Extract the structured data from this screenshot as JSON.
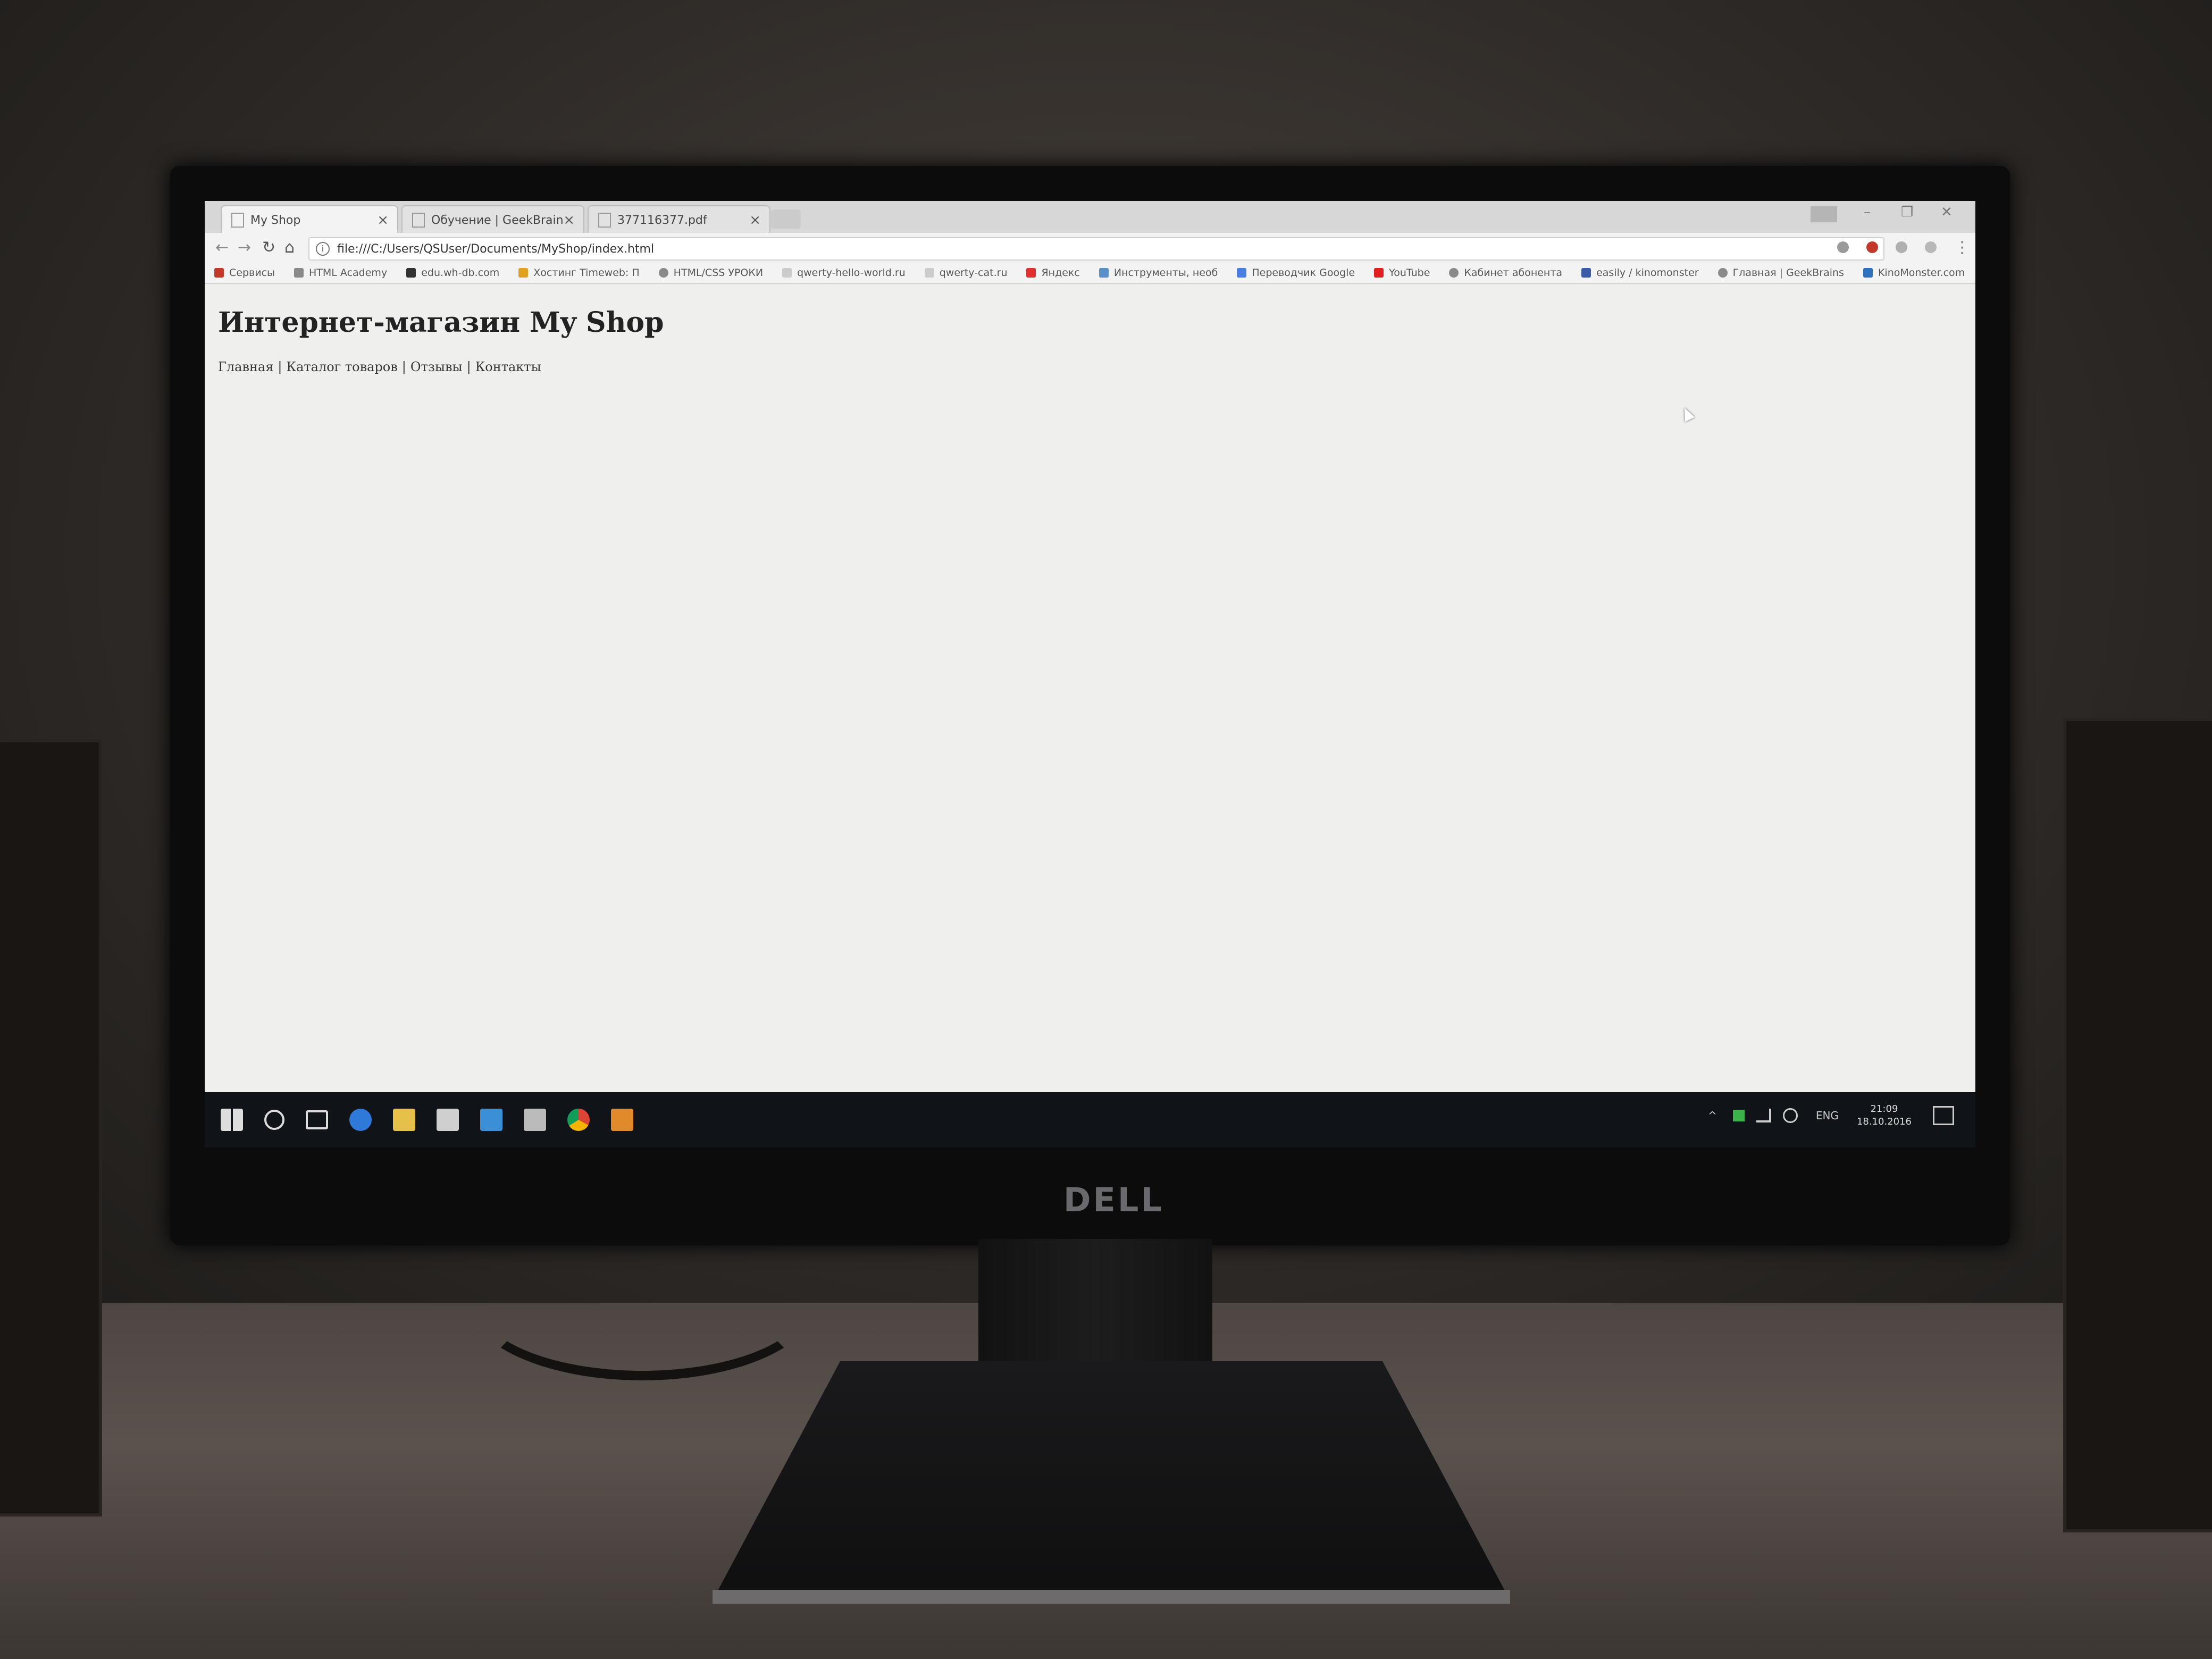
{
  "logo": {
    "brand_text": "DELL"
  },
  "browser": {
    "tabs": [
      {
        "title": "My Shop",
        "active": true
      },
      {
        "title": "Обучение | GeekBrains",
        "active": false
      },
      {
        "title": "377116377.pdf",
        "active": false
      }
    ],
    "close_glyph": "×",
    "address_url": "file:///C:/Users/QSUser/Documents/MyShop/index.html",
    "bookmarks": [
      "Сервисы",
      "HTML Academy",
      "edu.wh-db.com",
      "Хостинг Timeweb: П",
      "HTML/CSS УРОКИ",
      "qwerty-hello-world.ru",
      "qwerty-cat.ru",
      "Яндекс",
      "Инструменты, необ",
      "Переводчик Google",
      "YouTube",
      "Кабинет абонента",
      "easily / kinomonster",
      "Главная | GeekBrains",
      "KinoMonster.com"
    ]
  },
  "page": {
    "heading": "Интернет-магазин My Shop",
    "nav_links": [
      "Главная",
      "Каталог товаров",
      "Отзывы",
      "Контакты"
    ],
    "nav_separator": "|"
  },
  "taskbar": {
    "language": "ENG",
    "time": "21:09",
    "date": "18.10.2016"
  },
  "colors": {
    "screen_bg": "#ecebe8",
    "taskbar_bg": "#101418",
    "chrome_bg": "#f3f3f3"
  }
}
